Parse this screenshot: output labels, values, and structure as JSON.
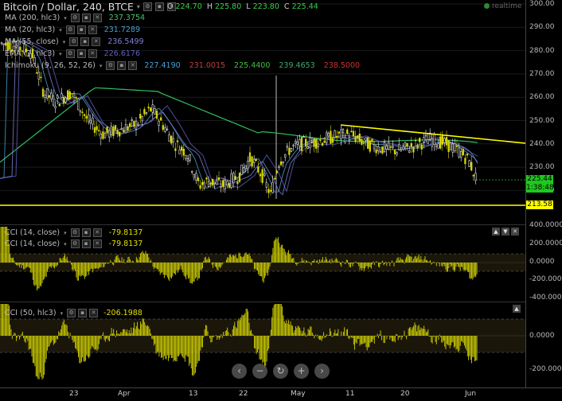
{
  "header": {
    "title": "Bitcoin / Dollar, 240, BTCE",
    "ohlc": [
      {
        "label": "O",
        "value": "224.70"
      },
      {
        "label": "H",
        "value": "225.80"
      },
      {
        "label": "L",
        "value": "223.80"
      },
      {
        "label": "C",
        "value": "225.44"
      }
    ],
    "realtime": "realtime"
  },
  "main_legend": [
    {
      "name": "MA (200, hlc3)",
      "values": [
        "237.3754"
      ],
      "colors": [
        "#3fc46d"
      ]
    },
    {
      "name": "MA (20, hlc3)",
      "values": [
        "231.7289"
      ],
      "colors": [
        "#4a9fd0"
      ]
    },
    {
      "name": "MA (55, close)",
      "values": [
        "236.5499"
      ],
      "colors": [
        "#8080d8"
      ]
    },
    {
      "name": "EMA (7, hlc3)",
      "values": [
        "226.6176"
      ],
      "colors": [
        "#6060c0"
      ]
    },
    {
      "name": "Ichimoku (9, 26, 52, 26)",
      "values": [
        "227.4190",
        "231.0015",
        "225.4400",
        "239.4653",
        "238.5000"
      ],
      "colors": [
        "#4aa0d8",
        "#c04040",
        "#40c040",
        "#3faa70",
        "#d03030"
      ]
    }
  ],
  "cci1_legend": [
    {
      "name": "CCI (14, close)",
      "value": "-79.8137"
    },
    {
      "name": "CCI (14, close)",
      "value": "-79.8137"
    }
  ],
  "cci2_legend": {
    "name": "CCI (50, hlc3)",
    "value": "-206.1988"
  },
  "price_axis": {
    "ticks": [
      "300.00",
      "290.00",
      "280.00",
      "270.00",
      "260.00",
      "250.00",
      "240.00",
      "230.00",
      "220.00"
    ],
    "tag_close": "225.44",
    "tag_timer": "1:38:48",
    "tag_support": "213.58"
  },
  "cci1_axis": [
    "400.0000",
    "200.0000",
    "0.0000",
    "-200.0000",
    "-400.0000"
  ],
  "cci2_axis": [
    "0.0000",
    "-200.0000"
  ],
  "x_axis": [
    "23",
    "Apr",
    "13",
    "22",
    "May",
    "11",
    "20",
    "Jun"
  ],
  "zoom": [
    "zoom-out",
    "minus",
    "reset",
    "plus",
    "scroll-right"
  ],
  "colors": {
    "up": "#ffffff",
    "down": "#d8d800",
    "trend": "#ffff00",
    "cci": "#d4d400",
    "ma200": "#2fbf60"
  }
}
